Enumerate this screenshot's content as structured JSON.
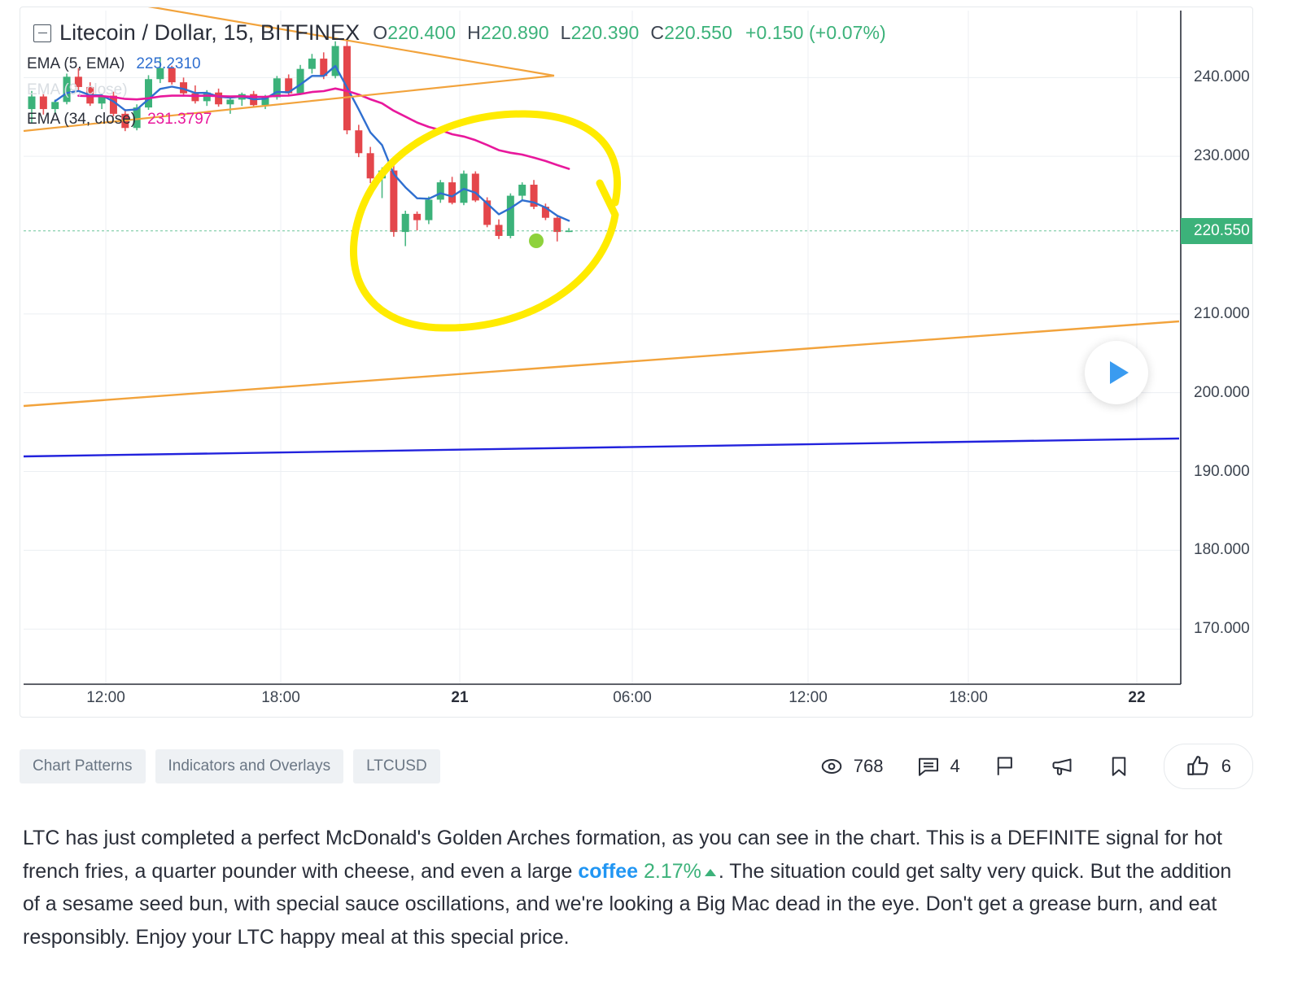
{
  "chart_header": {
    "collapse_icon": "minus-box-icon",
    "symbol_title": "Litecoin / Dollar, 15, BITFINEX",
    "ohlc": [
      {
        "key": "O",
        "value": "220.400"
      },
      {
        "key": "H",
        "value": "220.890"
      },
      {
        "key": "L",
        "value": "220.390"
      },
      {
        "key": "C",
        "value": "220.550"
      }
    ],
    "change": "+0.150 (+0.07%)"
  },
  "indicators": [
    {
      "name": "EMA (5, EMA)",
      "value": "225.2310",
      "color": "#2f6fd0",
      "faded": false
    },
    {
      "name": "EMA (9, close)",
      "value": "",
      "color": "#d8dde2",
      "faded": true
    },
    {
      "name": "EMA (34, close)",
      "value": "231.3797",
      "color": "#e8189c",
      "faded": false
    }
  ],
  "chart_data": {
    "type": "candlestick",
    "title": "Litecoin / Dollar, 15, BITFINEX",
    "xlabel": "",
    "ylabel": "",
    "grid": true,
    "ylim": [
      163.0,
      248.5
    ],
    "price_ticks": [
      "240.000",
      "230.000",
      "210.000",
      "200.000",
      "190.000",
      "180.000",
      "170.000"
    ],
    "price_tick_values": [
      240.0,
      230.0,
      210.0,
      200.0,
      190.0,
      180.0,
      170.0
    ],
    "current_price_label": "220.550",
    "current_price_value": 220.55,
    "time_ticks": [
      {
        "label": "12:00",
        "bold": false
      },
      {
        "label": "18:00",
        "bold": false
      },
      {
        "label": "21",
        "bold": true
      },
      {
        "label": "06:00",
        "bold": false
      },
      {
        "label": "12:00",
        "bold": false
      },
      {
        "label": "18:00",
        "bold": false
      },
      {
        "label": "22",
        "bold": true
      }
    ],
    "candle_up_color": "#3cb27a",
    "candle_down_color": "#e4464b",
    "candles": [
      {
        "o": 236.0,
        "h": 238.3,
        "l": 234.3,
        "c": 237.6
      },
      {
        "o": 237.6,
        "h": 238.1,
        "l": 235.3,
        "c": 236.0
      },
      {
        "o": 236.0,
        "h": 237.2,
        "l": 235.4,
        "c": 236.9
      },
      {
        "o": 236.9,
        "h": 240.5,
        "l": 236.6,
        "c": 240.1
      },
      {
        "o": 240.1,
        "h": 241.2,
        "l": 238.4,
        "c": 238.8
      },
      {
        "o": 238.8,
        "h": 239.4,
        "l": 236.4,
        "c": 236.7
      },
      {
        "o": 236.7,
        "h": 238.0,
        "l": 236.0,
        "c": 237.7
      },
      {
        "o": 237.7,
        "h": 238.2,
        "l": 235.1,
        "c": 235.4
      },
      {
        "o": 235.4,
        "h": 236.0,
        "l": 233.2,
        "c": 233.6
      },
      {
        "o": 233.6,
        "h": 236.6,
        "l": 233.3,
        "c": 236.2
      },
      {
        "o": 236.2,
        "h": 240.3,
        "l": 235.9,
        "c": 239.8
      },
      {
        "o": 239.8,
        "h": 242.6,
        "l": 239.3,
        "c": 241.2
      },
      {
        "o": 241.2,
        "h": 241.5,
        "l": 239.1,
        "c": 239.4
      },
      {
        "o": 239.4,
        "h": 240.0,
        "l": 237.6,
        "c": 238.0
      },
      {
        "o": 238.0,
        "h": 239.0,
        "l": 236.7,
        "c": 237.0
      },
      {
        "o": 237.0,
        "h": 238.4,
        "l": 236.4,
        "c": 238.1
      },
      {
        "o": 238.1,
        "h": 238.6,
        "l": 236.3,
        "c": 236.6
      },
      {
        "o": 236.6,
        "h": 237.6,
        "l": 235.4,
        "c": 237.2
      },
      {
        "o": 237.2,
        "h": 238.1,
        "l": 236.4,
        "c": 237.9
      },
      {
        "o": 237.9,
        "h": 238.3,
        "l": 236.2,
        "c": 236.5
      },
      {
        "o": 236.5,
        "h": 237.8,
        "l": 236.0,
        "c": 237.5
      },
      {
        "o": 237.5,
        "h": 240.2,
        "l": 237.2,
        "c": 239.9
      },
      {
        "o": 239.9,
        "h": 240.4,
        "l": 237.6,
        "c": 238.0
      },
      {
        "o": 238.0,
        "h": 241.6,
        "l": 237.8,
        "c": 241.1
      },
      {
        "o": 241.1,
        "h": 243.0,
        "l": 240.5,
        "c": 242.4
      },
      {
        "o": 242.4,
        "h": 243.2,
        "l": 239.8,
        "c": 240.2
      },
      {
        "o": 240.2,
        "h": 244.6,
        "l": 239.9,
        "c": 244.0
      },
      {
        "o": 244.0,
        "h": 244.8,
        "l": 232.8,
        "c": 233.3
      },
      {
        "o": 233.3,
        "h": 234.0,
        "l": 229.9,
        "c": 230.4
      },
      {
        "o": 230.4,
        "h": 231.2,
        "l": 226.6,
        "c": 227.2
      },
      {
        "o": 227.2,
        "h": 228.6,
        "l": 224.7,
        "c": 228.2
      },
      {
        "o": 228.2,
        "h": 228.9,
        "l": 219.8,
        "c": 220.4
      },
      {
        "o": 220.4,
        "h": 223.1,
        "l": 218.6,
        "c": 222.7
      },
      {
        "o": 222.7,
        "h": 223.0,
        "l": 220.6,
        "c": 221.9
      },
      {
        "o": 221.9,
        "h": 224.9,
        "l": 221.4,
        "c": 224.5
      },
      {
        "o": 224.5,
        "h": 227.0,
        "l": 224.1,
        "c": 226.7
      },
      {
        "o": 226.7,
        "h": 227.4,
        "l": 223.9,
        "c": 224.1
      },
      {
        "o": 224.1,
        "h": 228.2,
        "l": 223.8,
        "c": 227.8
      },
      {
        "o": 227.8,
        "h": 228.1,
        "l": 224.2,
        "c": 224.4
      },
      {
        "o": 224.4,
        "h": 224.8,
        "l": 221.0,
        "c": 221.3
      },
      {
        "o": 221.3,
        "h": 222.0,
        "l": 219.5,
        "c": 219.9
      },
      {
        "o": 219.9,
        "h": 225.3,
        "l": 219.6,
        "c": 225.0
      },
      {
        "o": 225.0,
        "h": 226.7,
        "l": 224.3,
        "c": 226.4
      },
      {
        "o": 226.4,
        "h": 227.0,
        "l": 223.3,
        "c": 223.6
      },
      {
        "o": 223.6,
        "h": 224.0,
        "l": 221.9,
        "c": 222.2
      },
      {
        "o": 222.2,
        "h": 222.5,
        "l": 219.2,
        "c": 220.4
      },
      {
        "o": 220.4,
        "h": 220.89,
        "l": 220.39,
        "c": 220.55
      }
    ],
    "overlays": [
      {
        "name": "ema-5-line",
        "color": "#2f6fd0"
      },
      {
        "name": "ema-34-line",
        "color": "#e8189c"
      },
      {
        "name": "triangle-trendlines",
        "color": "#f2a33c"
      },
      {
        "name": "long-support-trendline",
        "color": "#f2a33c"
      },
      {
        "name": "long-blue-trendline",
        "color": "#2222dd"
      },
      {
        "name": "yellow-circle-annotation",
        "color": "#ffeb00"
      },
      {
        "name": "green-dot-marker",
        "color": "#8ed23c"
      }
    ]
  },
  "play_button": {
    "icon": "play-icon"
  },
  "tags": [
    "Chart Patterns",
    "Indicators and Overlays",
    "LTCUSD"
  ],
  "stats": [
    {
      "icon": "eye-icon",
      "label": "768",
      "name": "views-stat"
    },
    {
      "icon": "comment-icon",
      "label": "4",
      "name": "comments-stat"
    },
    {
      "icon": "flag-icon",
      "label": "",
      "name": "flag-button"
    },
    {
      "icon": "megaphone-icon",
      "label": "",
      "name": "share-idea-button"
    },
    {
      "icon": "bookmark-icon",
      "label": "",
      "name": "bookmark-button"
    }
  ],
  "like": {
    "icon": "thumbs-up-icon",
    "count": "6"
  },
  "description": {
    "part1": "LTC has just completed a perfect McDonald's Golden Arches formation, as you can see in the chart. This is a DEFINITE signal for hot french fries, a quarter pounder with cheese, and even a large ",
    "link": "coffee",
    "percent": "2.17%",
    "part2": ". The situation could get salty very quick. But the addition of a sesame seed bun, with special sauce oscillations, and we're looking a Big Mac dead in the eye. Don't get a grease burn, and eat responsibly. Enjoy your LTC happy meal at this special price."
  }
}
